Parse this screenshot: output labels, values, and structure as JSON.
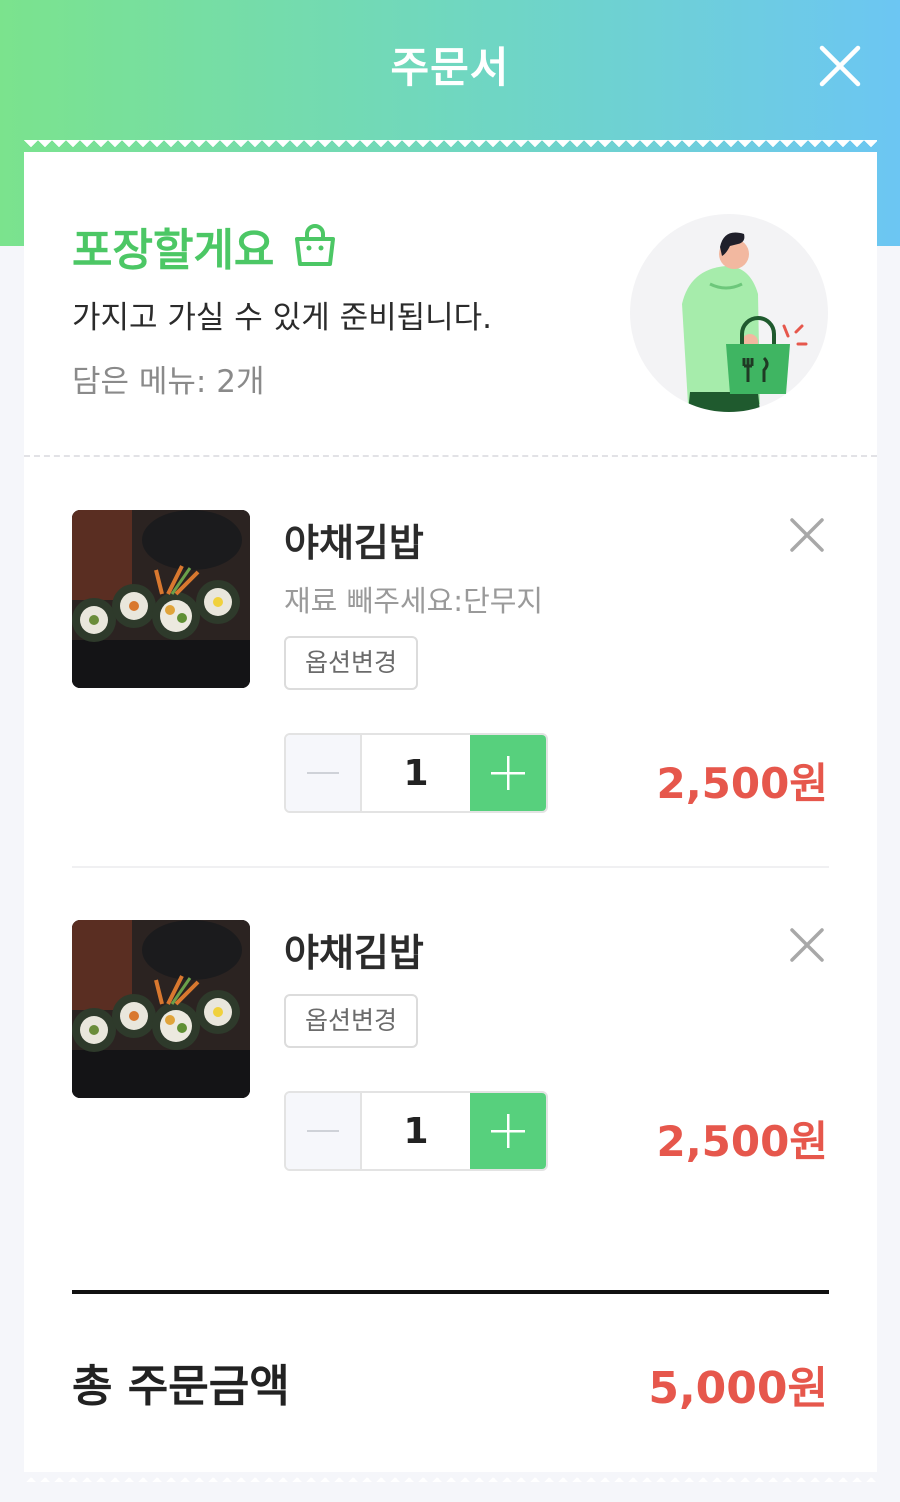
{
  "header": {
    "title": "주문서",
    "close_icon": "close-icon"
  },
  "takeout": {
    "title": "포장할게요",
    "icon": "shopping-bag-icon",
    "description": "가지고 가실 수 있게 준비됩니다.",
    "menu_count": "담은 메뉴: 2개",
    "illustration": "person-carrying-takeout-bag"
  },
  "items": [
    {
      "name": "야채김밥",
      "option_text": "재료 빼주세요:단무지",
      "option_button": "옵션변경",
      "quantity": "1",
      "price": "2,500원",
      "image": "kimbap-photo"
    },
    {
      "name": "야채김밥",
      "option_button": "옵션변경",
      "quantity": "1",
      "price": "2,500원",
      "image": "kimbap-photo"
    }
  ],
  "total": {
    "label": "총 주문금액",
    "value": "5,000원"
  },
  "colors": {
    "accent_green": "#57d07d",
    "title_green": "#4cc765",
    "price_red": "#e6574c"
  }
}
